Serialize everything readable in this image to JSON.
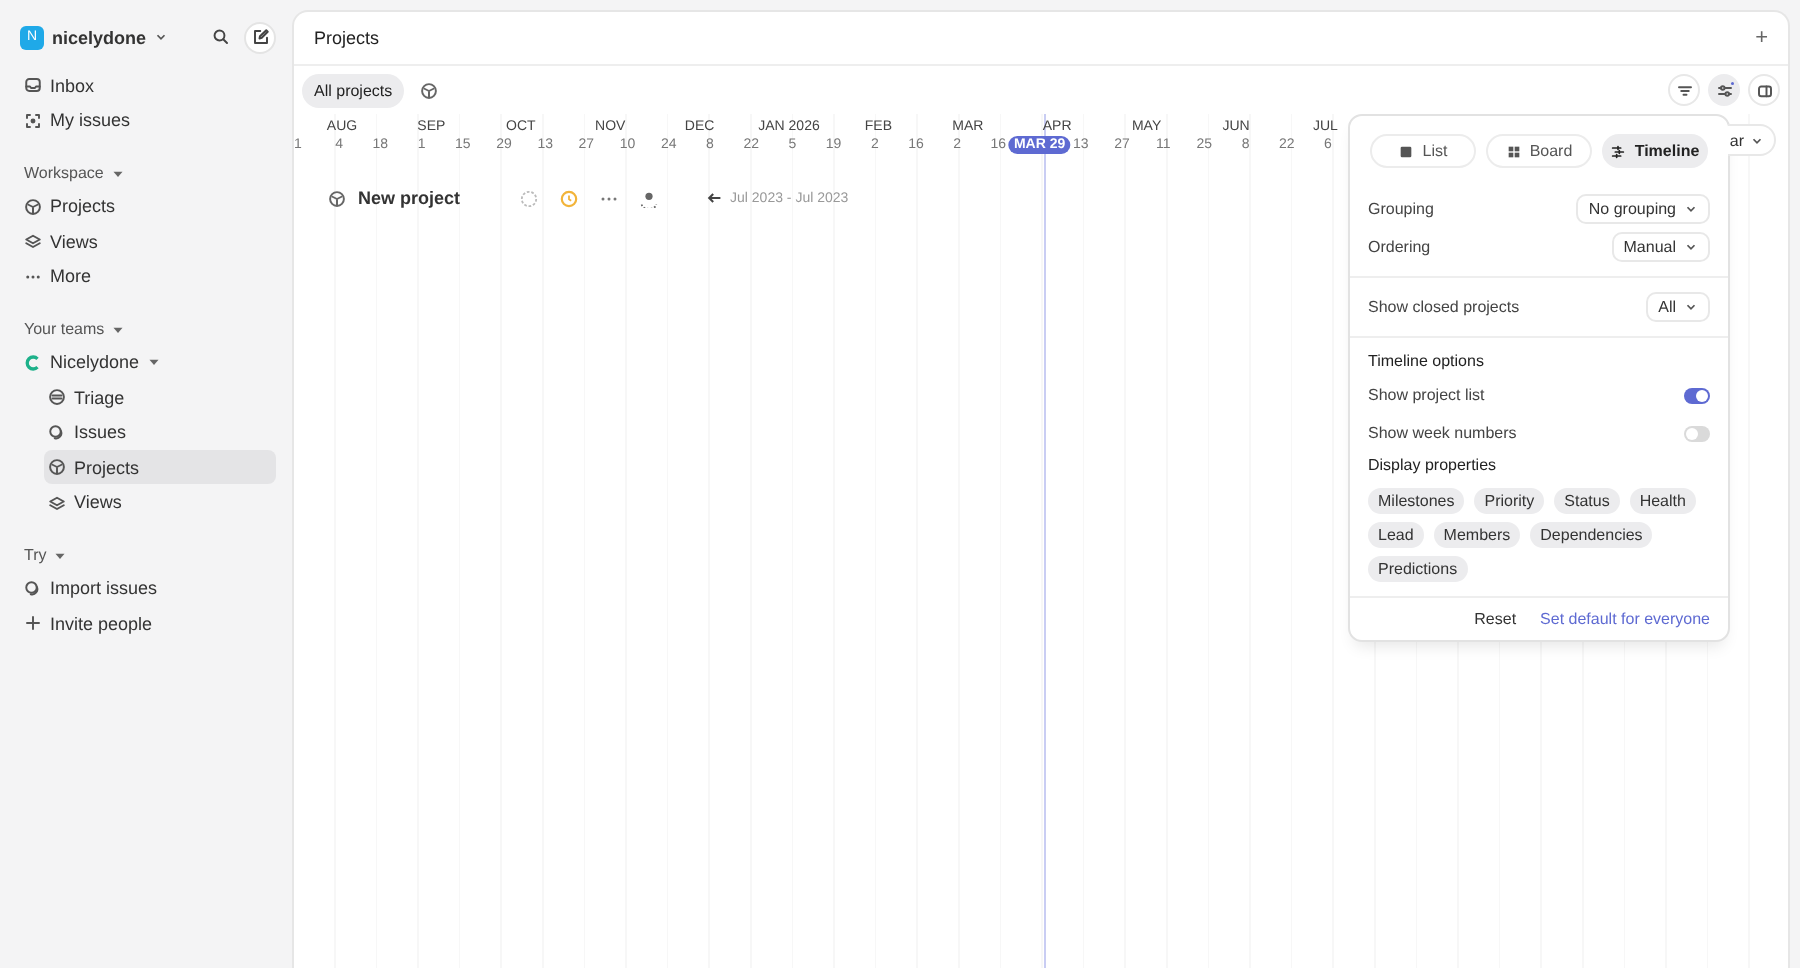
{
  "sidebar": {
    "workspace_name": "nicelydone",
    "avatar_letter": "N",
    "items": [
      {
        "label": "Inbox",
        "selected": false
      },
      {
        "label": "My issues",
        "selected": false
      }
    ],
    "sections": [
      {
        "title": "Workspace",
        "expanded": true,
        "items": [
          {
            "label": "Projects",
            "selected": false
          },
          {
            "label": "Views",
            "selected": false
          },
          {
            "label": "More",
            "selected": false
          }
        ]
      },
      {
        "title": "Your teams",
        "expanded": true,
        "team": {
          "name": "Nicelydone",
          "expanded": true,
          "children": [
            {
              "label": "Triage",
              "selected": false
            },
            {
              "label": "Issues",
              "selected": false
            },
            {
              "label": "Projects",
              "selected": true
            },
            {
              "label": "Views",
              "selected": false
            }
          ]
        }
      },
      {
        "title": "Try",
        "expanded": true,
        "items": [
          {
            "label": "Import issues",
            "selected": false
          },
          {
            "label": "Invite people",
            "selected": false
          }
        ]
      }
    ]
  },
  "panel": {
    "title": "Projects",
    "add_symbol": "+",
    "views": [
      {
        "label": "All projects",
        "selected": true
      }
    ],
    "partial_button": "ar"
  },
  "timeline": {
    "months": [
      "AUG",
      "SEP",
      "OCT",
      "NOV",
      "DEC",
      "JAN 2026",
      "FEB",
      "MAR",
      "APR",
      "MAY",
      "JUN",
      "JUL"
    ],
    "days": [
      {
        "label": "1",
        "kind": "day"
      },
      {
        "label": "4",
        "kind": "day"
      },
      {
        "label": "18",
        "kind": "day"
      },
      {
        "label": "1",
        "kind": "day"
      },
      {
        "label": "15",
        "kind": "day"
      },
      {
        "label": "29",
        "kind": "day"
      },
      {
        "label": "13",
        "kind": "day"
      },
      {
        "label": "27",
        "kind": "day"
      },
      {
        "label": "10",
        "kind": "day"
      },
      {
        "label": "24",
        "kind": "day"
      },
      {
        "label": "8",
        "kind": "day"
      },
      {
        "label": "22",
        "kind": "day"
      },
      {
        "label": "5",
        "kind": "day"
      },
      {
        "label": "19",
        "kind": "day"
      },
      {
        "label": "2",
        "kind": "day"
      },
      {
        "label": "16",
        "kind": "day"
      },
      {
        "label": "2",
        "kind": "day"
      },
      {
        "label": "16",
        "kind": "day"
      },
      {
        "label": "MAR 29",
        "kind": "today"
      },
      {
        "label": "13",
        "kind": "day"
      },
      {
        "label": "27",
        "kind": "day"
      },
      {
        "label": "11",
        "kind": "day"
      },
      {
        "label": "25",
        "kind": "day"
      },
      {
        "label": "8",
        "kind": "day"
      },
      {
        "label": "22",
        "kind": "day"
      },
      {
        "label": "6",
        "kind": "day"
      }
    ],
    "projects": [
      {
        "name": "New project",
        "dates": "Jul 2023 - Jul 2023"
      }
    ]
  },
  "display_menu": {
    "layouts": [
      {
        "label": "List",
        "selected": false
      },
      {
        "label": "Board",
        "selected": false
      },
      {
        "label": "Timeline",
        "selected": true
      }
    ],
    "selects": [
      {
        "label": "Grouping",
        "value": "No grouping"
      },
      {
        "label": "Ordering",
        "value": "Manual"
      }
    ],
    "closed_projects": {
      "label": "Show closed projects",
      "value": "All"
    },
    "timeline_options": {
      "title": "Timeline options",
      "toggles": [
        {
          "label": "Show project list",
          "on": true
        },
        {
          "label": "Show week numbers",
          "on": false
        }
      ]
    },
    "properties": {
      "title": "Display properties",
      "chips": [
        "Milestones",
        "Priority",
        "Status",
        "Health",
        "Lead",
        "Members",
        "Dependencies",
        "Predictions"
      ]
    },
    "actions": [
      {
        "label": "Reset",
        "kind": "plain"
      },
      {
        "label": "Set default for everyone",
        "kind": "link"
      }
    ]
  }
}
